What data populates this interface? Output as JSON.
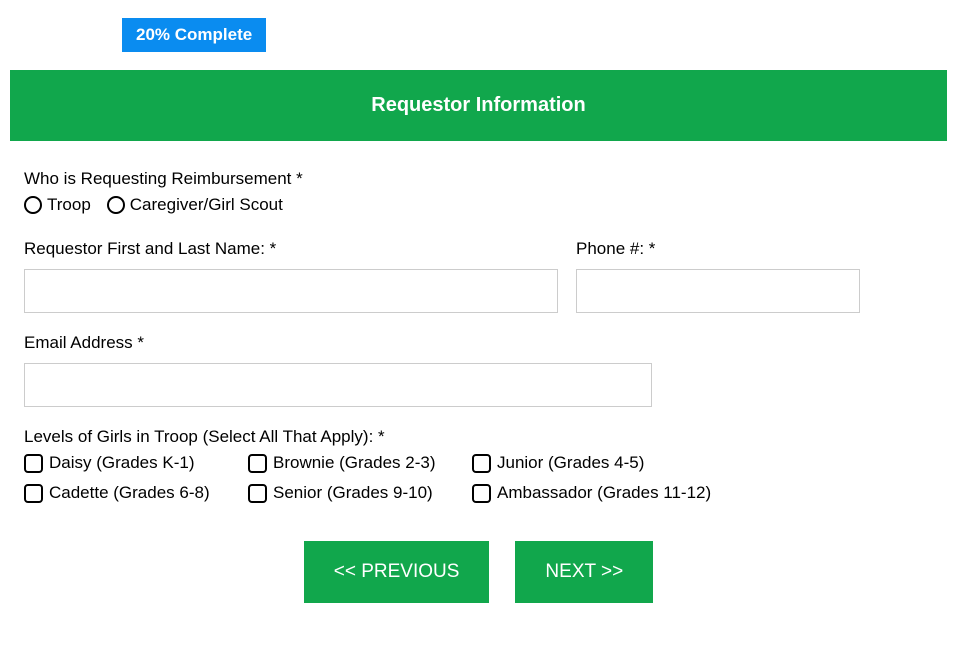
{
  "progress": {
    "label": "20% Complete"
  },
  "section": {
    "title": "Requestor Information"
  },
  "fields": {
    "requester_type": {
      "label": "Who is Requesting Reimbursement *",
      "options": {
        "troop": "Troop",
        "caregiver": "Caregiver/Girl Scout"
      }
    },
    "name": {
      "label": "Requestor First and Last Name: *",
      "value": ""
    },
    "phone": {
      "label": "Phone #: *",
      "value": ""
    },
    "email": {
      "label": "Email Address *",
      "value": ""
    },
    "levels": {
      "label": "Levels of Girls in Troop (Select All That Apply): *",
      "options": {
        "daisy": "Daisy (Grades K-1)",
        "brownie": "Brownie (Grades 2-3)",
        "junior": "Junior (Grades 4-5)",
        "cadette": "Cadette (Grades 6-8)",
        "senior": "Senior (Grades 9-10)",
        "ambassador": "Ambassador (Grades 11-12)"
      }
    }
  },
  "buttons": {
    "previous": "<< PREVIOUS",
    "next": "NEXT >>"
  }
}
